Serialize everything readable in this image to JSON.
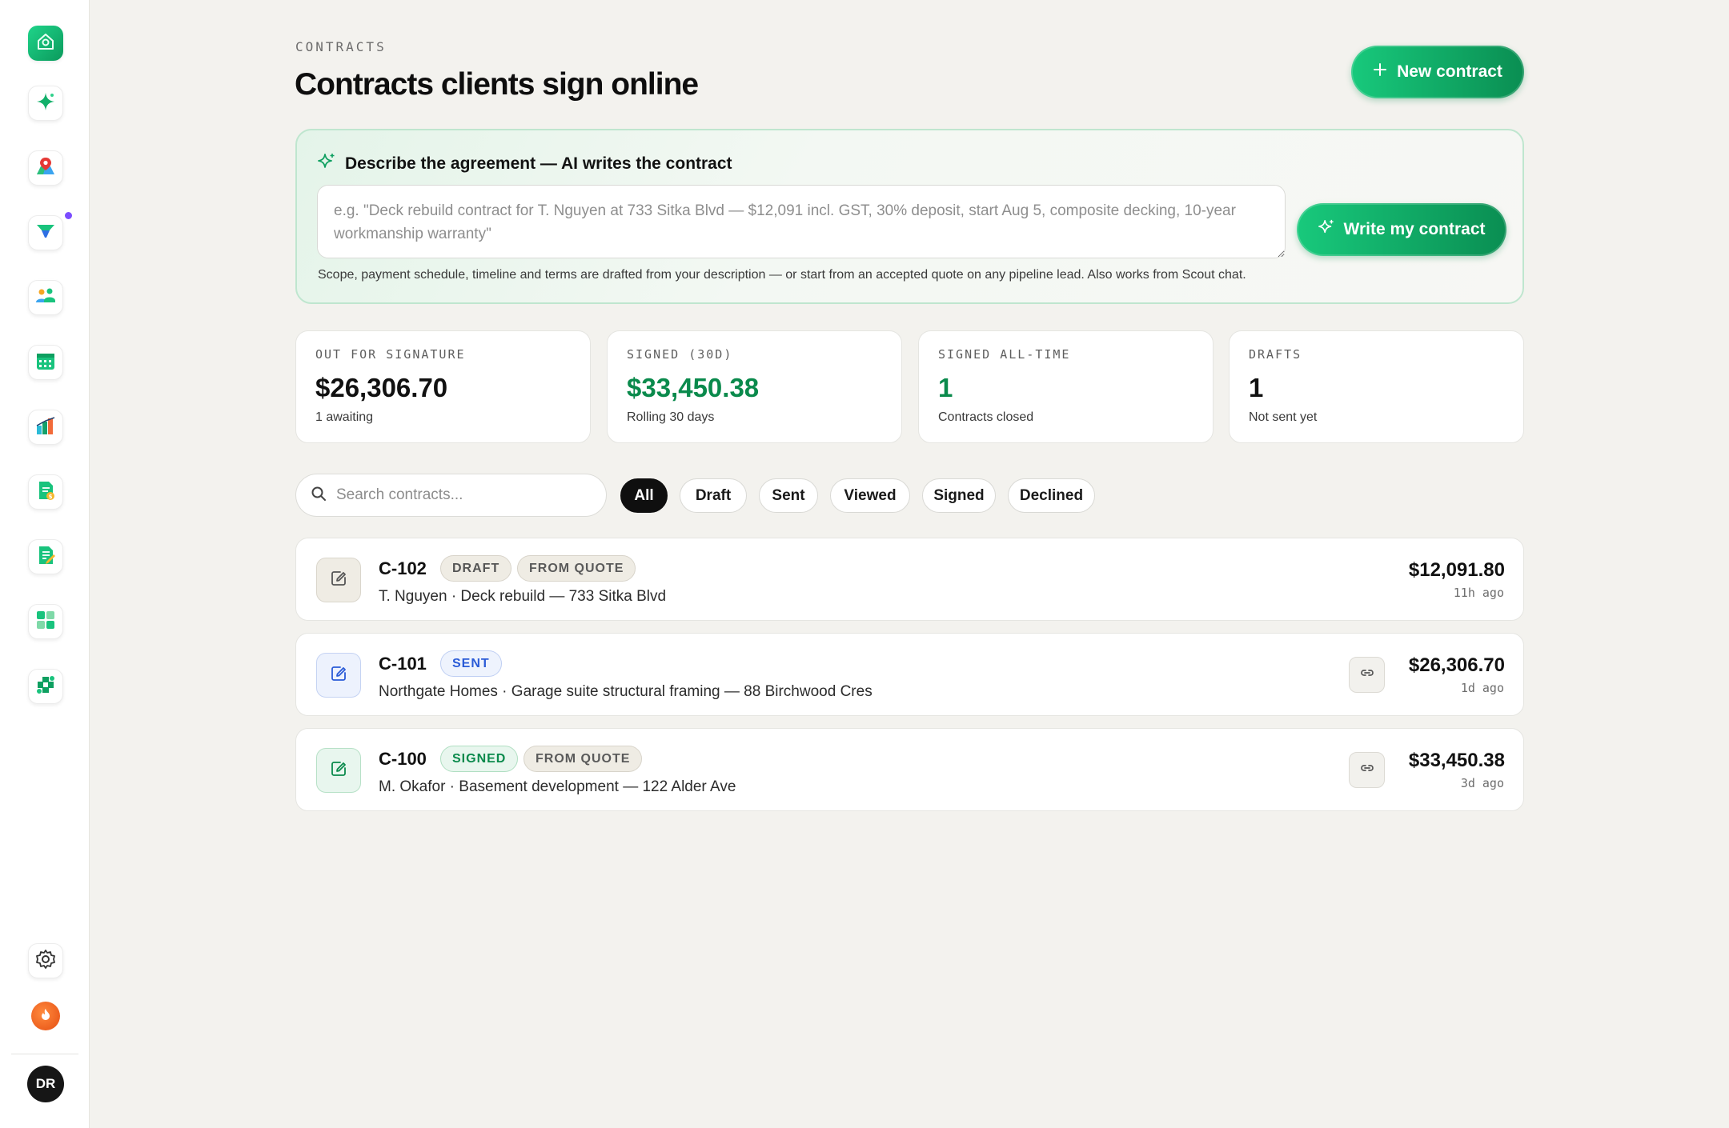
{
  "sidebar": {
    "items": [
      {
        "icon": "home-icon"
      },
      {
        "icon": "sparkle-icon"
      },
      {
        "icon": "map-pin-icon"
      },
      {
        "icon": "funnel-icon"
      },
      {
        "icon": "team-icon"
      },
      {
        "icon": "calendar-icon"
      },
      {
        "icon": "bar-chart-icon"
      },
      {
        "icon": "invoice-icon"
      },
      {
        "icon": "contract-icon"
      },
      {
        "icon": "grid-icon"
      },
      {
        "icon": "puzzle-icon"
      }
    ],
    "bottom": [
      {
        "icon": "gear-icon"
      },
      {
        "icon": "fire-icon"
      }
    ],
    "avatar_initials": "DR",
    "accent": "#12b06a",
    "notification_color": "#7c4dff"
  },
  "header": {
    "eyebrow": "CONTRACTS",
    "title": "Contracts clients sign online",
    "new_button_label": "New contract"
  },
  "ai_panel": {
    "heading": "Describe the agreement — AI writes the contract",
    "placeholder": "e.g. \"Deck rebuild contract for T. Nguyen at 733 Sitka Blvd — $12,091 incl. GST, 30% deposit, start Aug 5, composite decking, 10-year workmanship warranty\"",
    "button_label": "Write my contract",
    "note": "Scope, payment schedule, timeline and terms are drafted from your description — or start from an accepted quote on any pipeline lead. Also works from Scout chat."
  },
  "stats": [
    {
      "label": "OUT FOR SIGNATURE",
      "value": "$26,306.70",
      "sub": "1 awaiting"
    },
    {
      "label": "SIGNED (30D)",
      "value": "$33,450.38",
      "sub": "Rolling 30 days"
    },
    {
      "label": "SIGNED ALL-TIME",
      "value": "1",
      "sub": "Contracts closed"
    },
    {
      "label": "DRAFTS",
      "value": "1",
      "sub": "Not sent yet"
    }
  ],
  "filters": {
    "search_placeholder": "Search contracts...",
    "chips": [
      "All",
      "Draft",
      "Sent",
      "Viewed",
      "Signed",
      "Declined"
    ],
    "active": "All"
  },
  "contracts": [
    {
      "id": "C-102",
      "status": "DRAFT",
      "tag": "FROM QUOTE",
      "subtitle": "T. Nguyen · Deck rebuild — 733 Sitka Blvd",
      "amount": "$12,091.80",
      "time": "11h ago"
    },
    {
      "id": "C-101",
      "status": "SENT",
      "tag": "",
      "subtitle": "Northgate Homes · Garage suite structural framing — 88 Birchwood Cres",
      "amount": "$26,306.70",
      "time": "1d ago"
    },
    {
      "id": "C-100",
      "status": "SIGNED",
      "tag": "FROM QUOTE",
      "subtitle": "M. Okafor · Basement development — 122 Alder Ave",
      "amount": "$33,450.38",
      "time": "3d ago"
    }
  ]
}
